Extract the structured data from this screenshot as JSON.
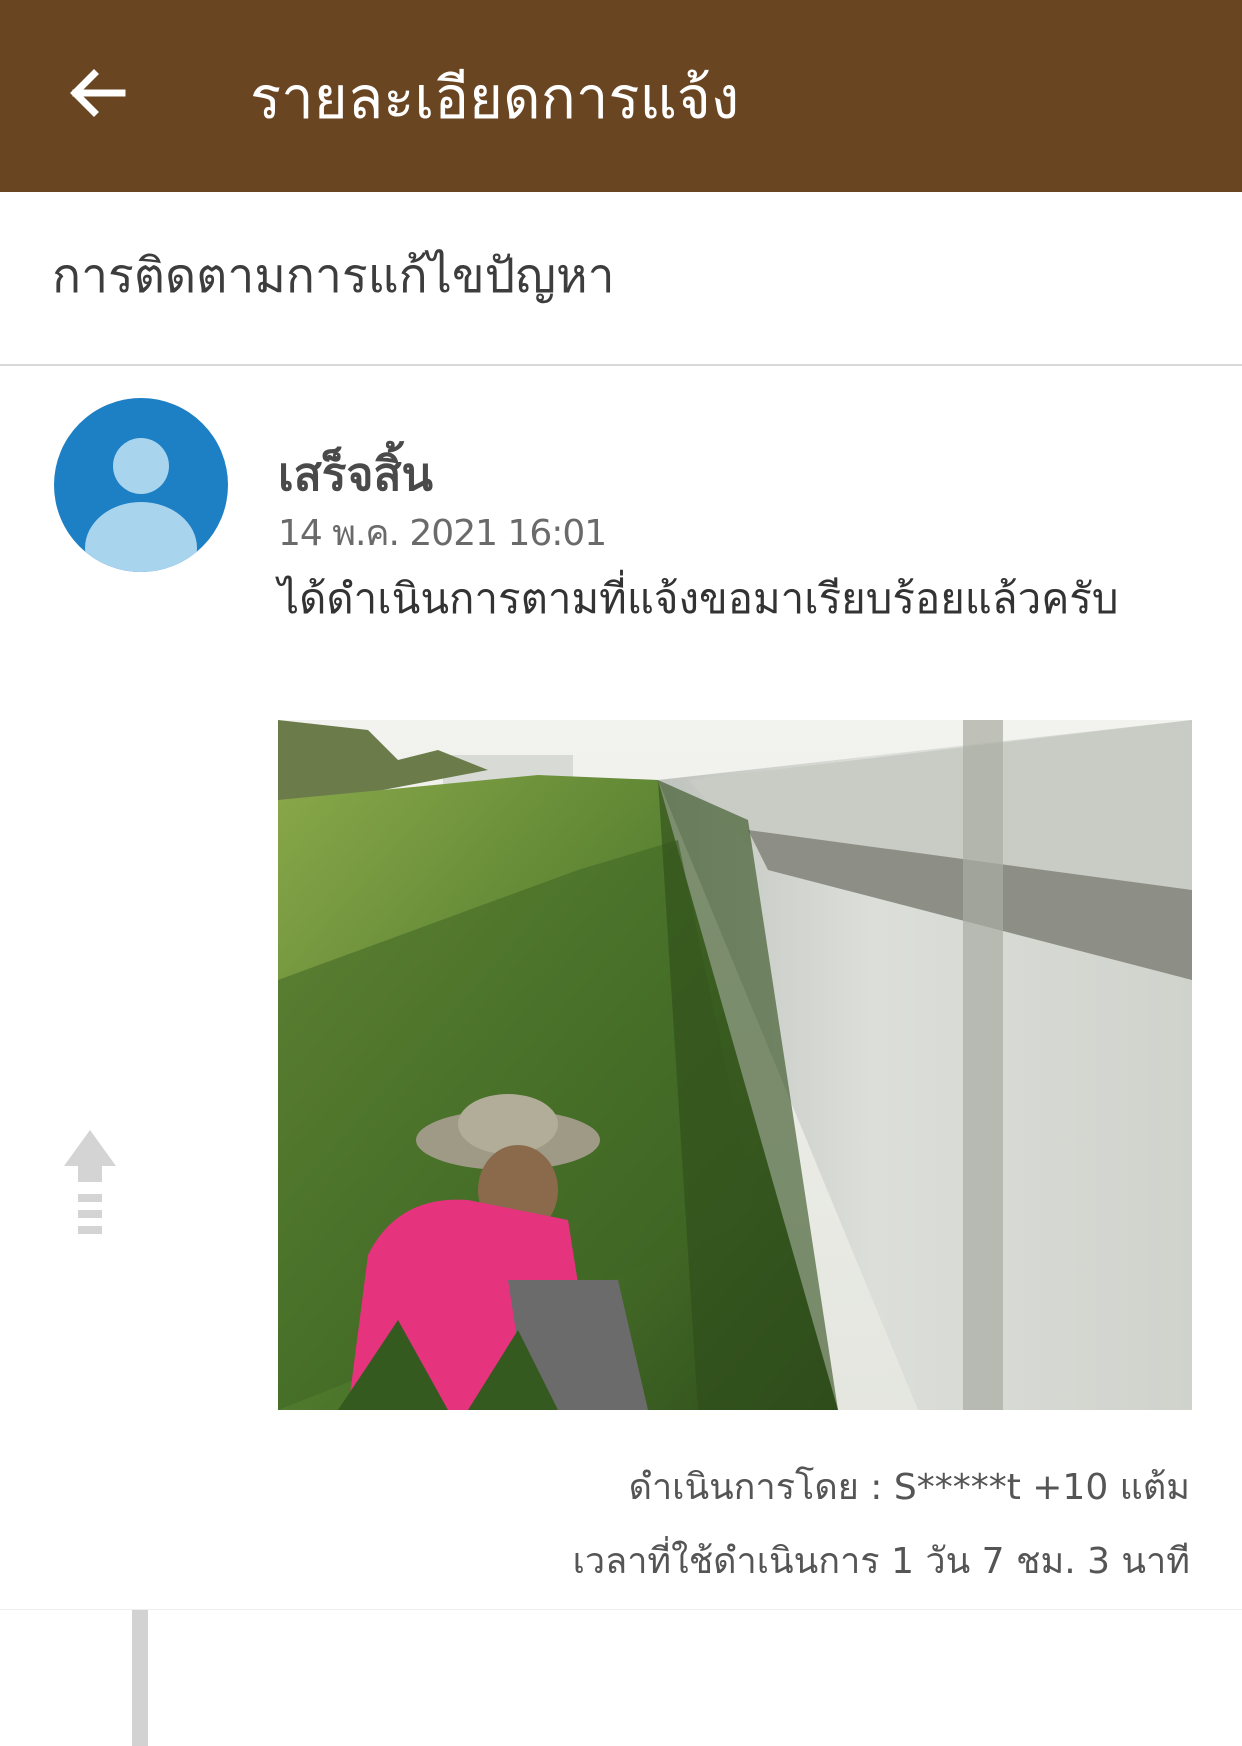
{
  "appbar": {
    "title": "รายละเอียดการแจ้ง",
    "back_icon": "arrow-left-icon",
    "background": "#6a4522"
  },
  "section": {
    "title": "การติดตามการแก้ไขปัญหา"
  },
  "timeline": [
    {
      "status": "เสร็จสิ้น",
      "timestamp": "14 พ.ค. 2021 16:01",
      "message": "ได้ดำเนินการตามที่แจ้งขอมาเรียบร้อยแล้วครับ",
      "operator": "ดำเนินการโดย : S*****t  +10 แต้ม",
      "duration": "เวลาที่ใช้ดำเนินการ 1 วัน 7 ชม. 3 นาที",
      "avatar_icon": "person-icon",
      "avatar_color": "#1d7fc4"
    }
  ],
  "scroll_top_icon": "arrow-up-icon"
}
